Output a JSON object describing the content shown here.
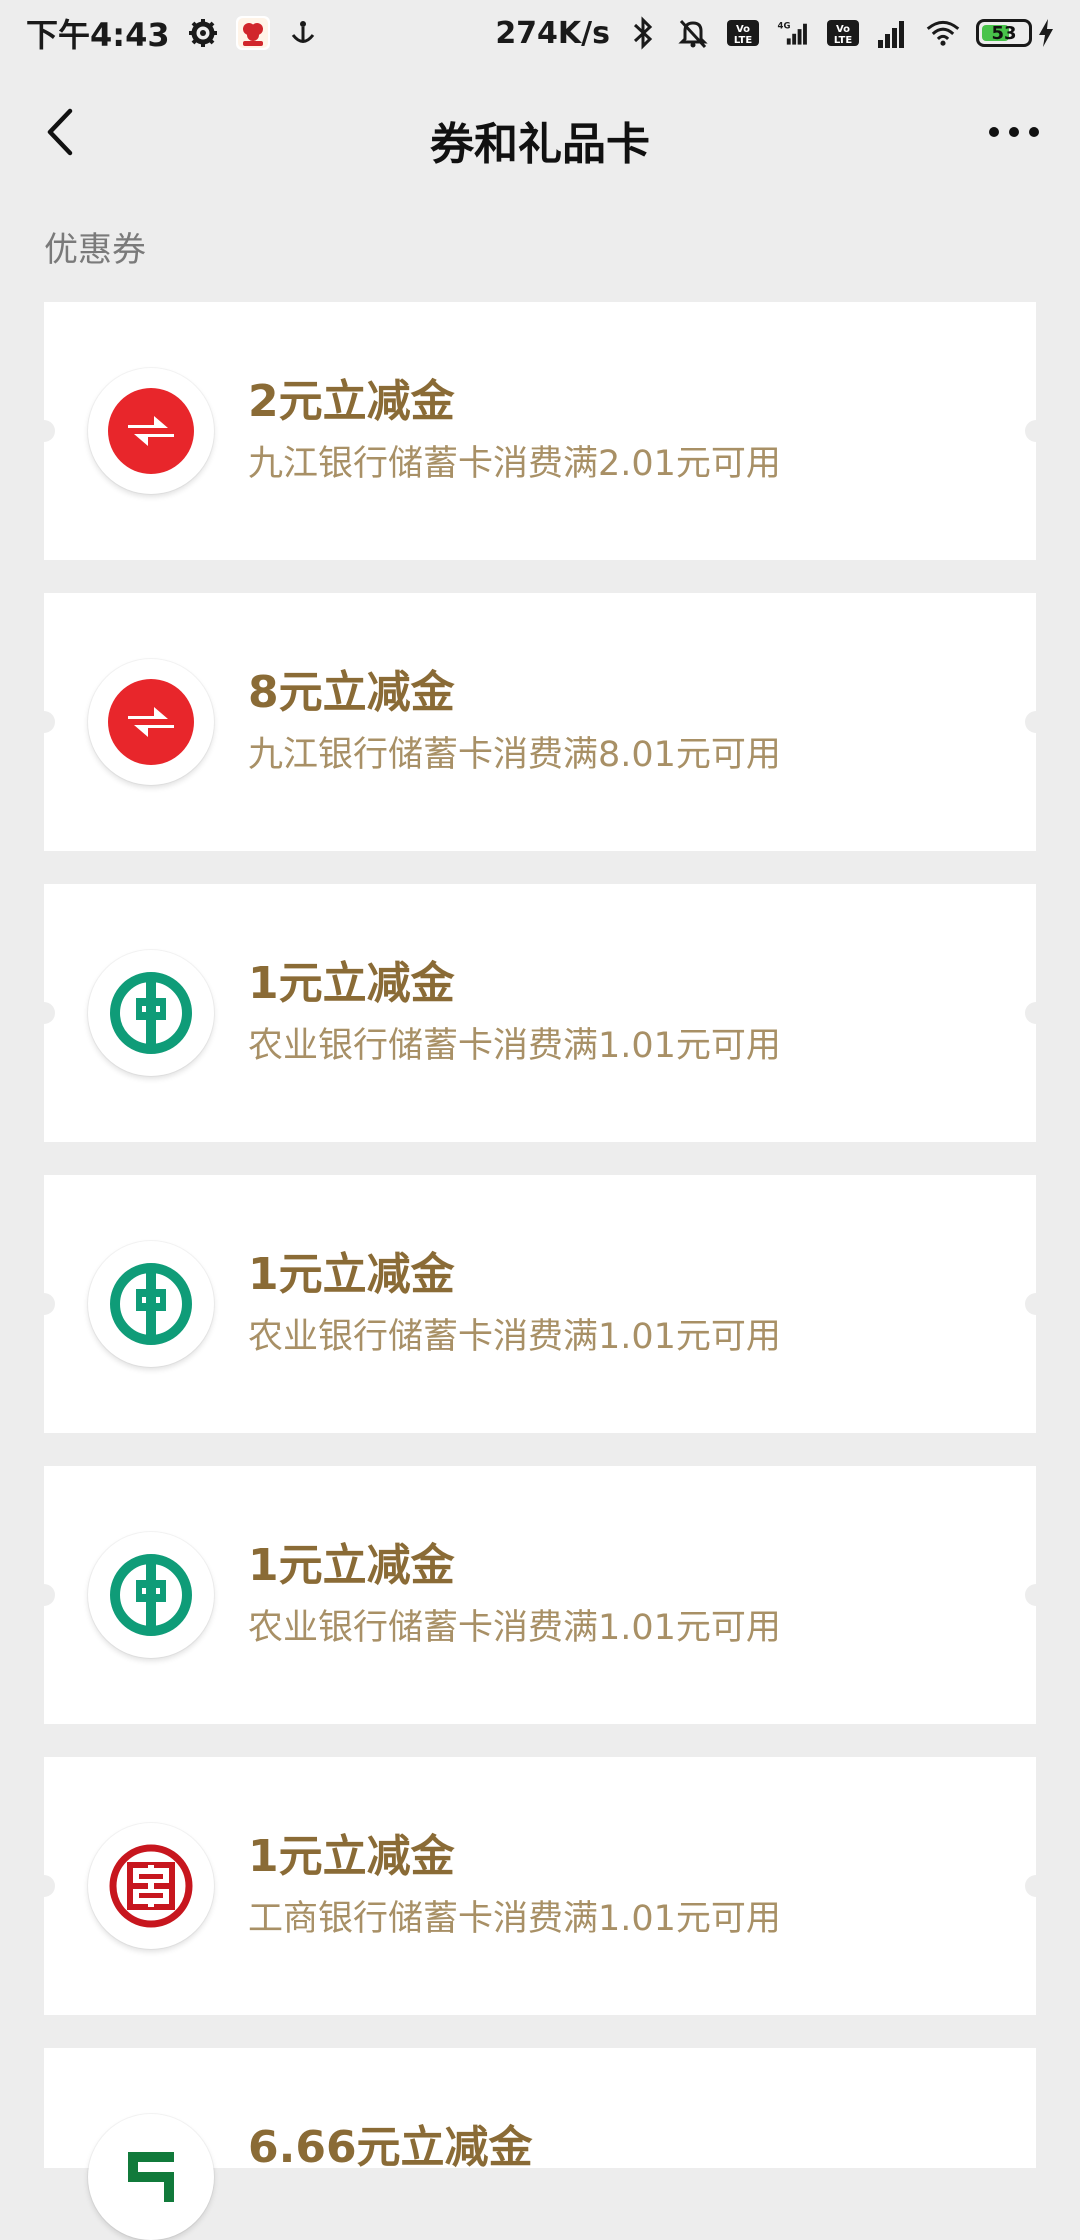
{
  "status_bar": {
    "time": "下午4:43",
    "net_speed": "274K/s",
    "network_4g": "4G",
    "volte_label": "Vo LTE",
    "battery_level": "53",
    "battery_fill_percent": 53
  },
  "nav": {
    "title": "券和礼品卡"
  },
  "section": {
    "title": "优惠券"
  },
  "colors": {
    "background": "#ededed",
    "card": "#ffffff",
    "coupon_title": "#8a6b36",
    "coupon_desc": "#a89066",
    "jiujiang_red": "#e8262b",
    "abc_green": "#0f9c78",
    "icbc_red": "#c7161e",
    "postal_green": "#117a3b"
  },
  "coupons": [
    {
      "title": "2元立减金",
      "description": "九江银行储蓄卡消费满2.01元可用",
      "bank_icon": "jiujiang-bank-icon"
    },
    {
      "title": "8元立减金",
      "description": "九江银行储蓄卡消费满8.01元可用",
      "bank_icon": "jiujiang-bank-icon"
    },
    {
      "title": "1元立减金",
      "description": "农业银行储蓄卡消费满1.01元可用",
      "bank_icon": "agricultural-bank-icon"
    },
    {
      "title": "1元立减金",
      "description": "农业银行储蓄卡消费满1.01元可用",
      "bank_icon": "agricultural-bank-icon"
    },
    {
      "title": "1元立减金",
      "description": "农业银行储蓄卡消费满1.01元可用",
      "bank_icon": "agricultural-bank-icon"
    },
    {
      "title": "1元立减金",
      "description": "工商银行储蓄卡消费满1.01元可用",
      "bank_icon": "icbc-bank-icon"
    },
    {
      "title": "6.66元立减金",
      "description": "",
      "bank_icon": "postal-bank-icon"
    }
  ]
}
